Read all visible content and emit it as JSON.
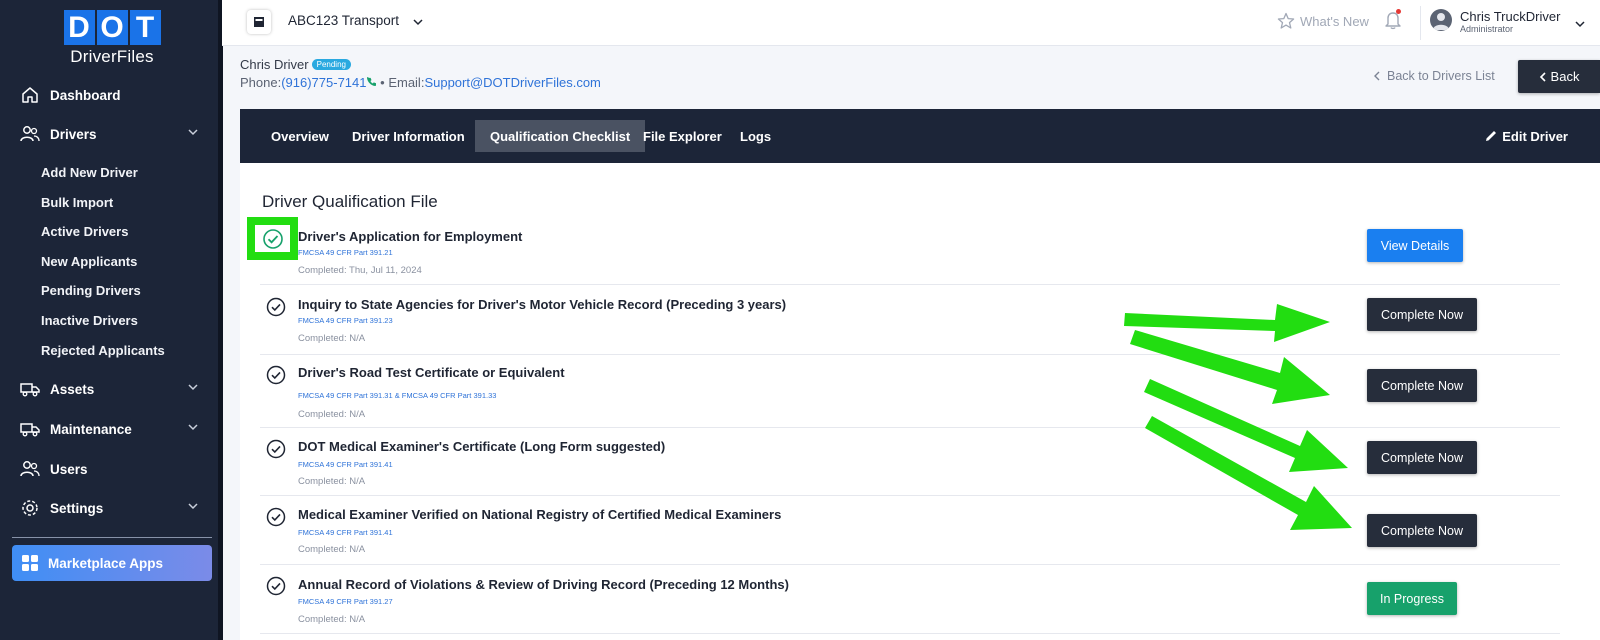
{
  "brand": {
    "letters": [
      "D",
      "O",
      "T"
    ],
    "subtitle": "DriverFiles"
  },
  "sidebar": {
    "items": [
      {
        "label": "Dashboard",
        "icon": "home-icon"
      },
      {
        "label": "Drivers",
        "icon": "users-icon"
      },
      {
        "label": "Assets",
        "icon": "truck-icon"
      },
      {
        "label": "Maintenance",
        "icon": "truck-icon"
      },
      {
        "label": "Users",
        "icon": "users-icon"
      },
      {
        "label": "Settings",
        "icon": "gear-icon"
      }
    ],
    "driver_subitems": [
      "Add New Driver",
      "Bulk Import",
      "Active Drivers",
      "New Applicants",
      "Pending Drivers",
      "Inactive Drivers",
      "Rejected Applicants"
    ],
    "marketplace_label": "Marketplace Apps"
  },
  "topbar": {
    "company": "ABC123 Transport",
    "whats_new": "What's New",
    "user_name": "Chris TruckDriver",
    "user_role": "Administrator"
  },
  "driver": {
    "name": "Chris Driver",
    "status": "Pending",
    "phone_label": "Phone:",
    "phone": "(916)775-7141",
    "separator": "•",
    "email_label": "Email:",
    "email": "Support@DOTDriverFiles.com",
    "back_list": "Back to Drivers List",
    "back_button": "Back"
  },
  "tabs": {
    "items": [
      "Overview",
      "Driver Information",
      "Qualification Checklist",
      "File Explorer",
      "Logs"
    ],
    "active": "Qualification Checklist",
    "edit_label": "Edit Driver"
  },
  "qualification": {
    "title": "Driver Qualification File",
    "items": [
      {
        "title": "Driver's Application for Employment",
        "reference": "FMCSA 49 CFR Part 391.21",
        "completed": "Completed: Thu, Jul 11, 2024",
        "action": "View Details",
        "status_color": "#1a7ff0"
      },
      {
        "title": "Inquiry to State Agencies for Driver's Motor Vehicle Record (Preceding 3 years)",
        "reference": "FMCSA 49 CFR Part 391.23",
        "completed": "Completed: N/A",
        "action": "Complete Now",
        "status_color": "#262d3b"
      },
      {
        "title": "Driver's Road Test Certificate or Equivalent",
        "reference": "FMCSA 49 CFR Part 391.31 & FMCSA 49 CFR Part 391.33",
        "completed": "Completed: N/A",
        "action": "Complete Now",
        "status_color": "#262d3b"
      },
      {
        "title": "DOT Medical Examiner's Certificate (Long Form suggested)",
        "reference": "FMCSA 49 CFR Part 391.41",
        "completed": "Completed: N/A",
        "action": "Complete Now",
        "status_color": "#262d3b"
      },
      {
        "title": "Medical Examiner Verified on National Registry of Certified Medical Examiners",
        "reference": "FMCSA 49 CFR Part 391.41",
        "completed": "Completed: N/A",
        "action": "Complete Now",
        "status_color": "#262d3b"
      },
      {
        "title": "Annual Record of Violations & Review of Driving Record (Preceding 12 Months)",
        "reference": "FMCSA 49 CFR Part 391.27",
        "completed": "Completed: N/A",
        "action": "In Progress",
        "status_color": "#17a16b"
      }
    ]
  },
  "annotation_color": "#22dd11"
}
